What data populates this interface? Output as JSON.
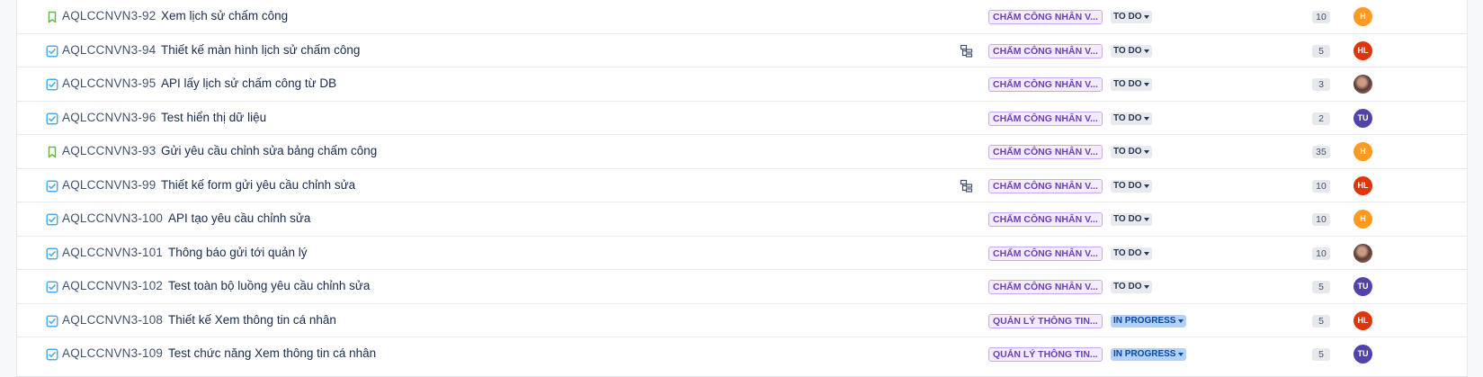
{
  "colors": {
    "story_icon": "#63ba3c",
    "task_icon": "#4bade8",
    "epic_bg": "#f3ebff",
    "epic_text": "#6c3fb5",
    "todo_bg": "#e8eaee",
    "progress_bg": "#b3d1f8",
    "avatar_orange": "#ff991f",
    "avatar_red": "#de350b",
    "avatar_purple": "#5243aa"
  },
  "rows": [
    {
      "type": "story-icon",
      "key": "AQLCCNVN3-92",
      "summary": "Xem lịch sử chấm công",
      "has_child_icon": false,
      "epic": "CHẤM CÔNG NHÂN V...",
      "status": "TO DO",
      "status_kind": "todo",
      "points": "10",
      "assignee": {
        "initials": "H",
        "color": "#ff991f",
        "photo": false
      }
    },
    {
      "type": "task-icon",
      "key": "AQLCCNVN3-94",
      "summary": "Thiết kế màn hình lịch sử chấm công",
      "has_child_icon": true,
      "epic": "CHẤM CÔNG NHÂN V...",
      "status": "TO DO",
      "status_kind": "todo",
      "points": "5",
      "assignee": {
        "initials": "HL",
        "color": "#de350b",
        "photo": false
      }
    },
    {
      "type": "task-icon",
      "key": "AQLCCNVN3-95",
      "summary": "API lấy lịch sử chấm công từ DB",
      "has_child_icon": false,
      "epic": "CHẤM CÔNG NHÂN V...",
      "status": "TO DO",
      "status_kind": "todo",
      "points": "3",
      "assignee": {
        "initials": "",
        "color": "#8a6a5e",
        "photo": true
      }
    },
    {
      "type": "task-icon",
      "key": "AQLCCNVN3-96",
      "summary": "Test hiển thị dữ liệu",
      "has_child_icon": false,
      "epic": "CHẤM CÔNG NHÂN V...",
      "status": "TO DO",
      "status_kind": "todo",
      "points": "2",
      "assignee": {
        "initials": "TU",
        "color": "#5243aa",
        "photo": false
      }
    },
    {
      "type": "story-icon",
      "key": "AQLCCNVN3-93",
      "summary": "Gửi yêu cầu chỉnh sửa bảng chấm công",
      "has_child_icon": false,
      "epic": "CHẤM CÔNG NHÂN V...",
      "status": "TO DO",
      "status_kind": "todo",
      "points": "35",
      "assignee": {
        "initials": "H",
        "color": "#ff991f",
        "photo": false
      }
    },
    {
      "type": "task-icon",
      "key": "AQLCCNVN3-99",
      "summary": "Thiết kế form gửi yêu cầu chỉnh sửa",
      "has_child_icon": true,
      "epic": "CHẤM CÔNG NHÂN V...",
      "status": "TO DO",
      "status_kind": "todo",
      "points": "10",
      "assignee": {
        "initials": "HL",
        "color": "#de350b",
        "photo": false
      }
    },
    {
      "type": "task-icon",
      "key": "AQLCCNVN3-100",
      "summary": "API tạo yêu cầu chỉnh sửa",
      "has_child_icon": false,
      "epic": "CHẤM CÔNG NHÂN V...",
      "status": "TO DO",
      "status_kind": "todo",
      "points": "10",
      "assignee": {
        "initials": "H",
        "color": "#ff991f",
        "photo": false
      }
    },
    {
      "type": "task-icon",
      "key": "AQLCCNVN3-101",
      "summary": "Thông báo gửi tới quản lý",
      "has_child_icon": false,
      "epic": "CHẤM CÔNG NHÂN V...",
      "status": "TO DO",
      "status_kind": "todo",
      "points": "10",
      "assignee": {
        "initials": "",
        "color": "#8a6a5e",
        "photo": true
      }
    },
    {
      "type": "task-icon",
      "key": "AQLCCNVN3-102",
      "summary": "Test toàn bộ luồng yêu cầu chỉnh sửa",
      "has_child_icon": false,
      "epic": "CHẤM CÔNG NHÂN V...",
      "status": "TO DO",
      "status_kind": "todo",
      "points": "5",
      "assignee": {
        "initials": "TU",
        "color": "#5243aa",
        "photo": false
      }
    },
    {
      "type": "task-icon",
      "key": "AQLCCNVN3-108",
      "summary": "Thiết kế Xem thông tin cá nhân",
      "has_child_icon": false,
      "epic": "QUẢN LÝ THÔNG TIN...",
      "status": "IN PROGRESS",
      "status_kind": "progress",
      "points": "5",
      "assignee": {
        "initials": "HL",
        "color": "#de350b",
        "photo": false
      }
    },
    {
      "type": "task-icon",
      "key": "AQLCCNVN3-109",
      "summary": "Test chức năng Xem thông tin cá nhân",
      "has_child_icon": false,
      "epic": "QUẢN LÝ THÔNG TIN...",
      "status": "IN PROGRESS",
      "status_kind": "progress",
      "points": "5",
      "assignee": {
        "initials": "TU",
        "color": "#5243aa",
        "photo": false
      }
    }
  ]
}
